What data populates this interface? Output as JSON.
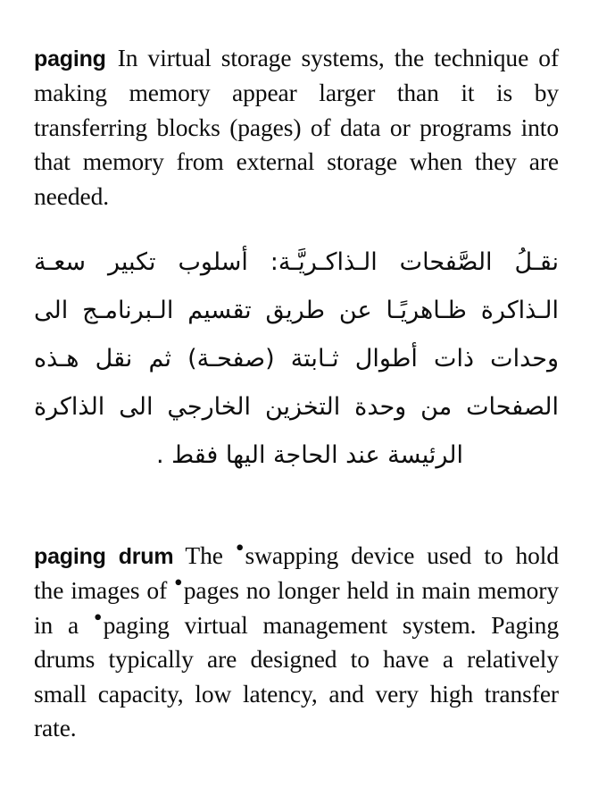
{
  "page": {
    "background_color": "#ffffff",
    "text_color": "#0d0d0d"
  },
  "entries": [
    {
      "headword": "paging",
      "definition_text": "In virtual storage systems, the technique of making memory appear larger than it is by transferring blocks (pages) of data or programs into that memory from external storage when they are needed.",
      "lines": [
        "In virtual storage systems, the",
        "technique of making memory appear lar-",
        "ger than it is by transferring blocks (pages)",
        "of data or programs into that memory from",
        "external storage when they are needed."
      ]
    },
    {
      "headword": "paging drum",
      "definition_text": "The •swapping device used to hold the images of •pages no longer held in main memory in a •paging virtual management system. Paging drums typically are designed to have a relatively small capacity, low latency, and very high transfer rate.",
      "lines": [
        "The •swapping device",
        "used to hold the images of •pages no longer",
        "held in main memory in a •paging virtual",
        "management system. Paging drums typi-",
        "cally are designed to have a relatively small",
        "capacity, low latency, and very high trans-",
        "fer rate."
      ],
      "cross_reference_marks": [
        "swapping",
        "pages",
        "paging"
      ]
    }
  ],
  "arabic": {
    "headword": "نقلُ الصَّفحات الـذاكـريَّـة",
    "full_text": "نقلُ الصَّفحات الـذاكـريَّـة: أسلوب تكبير سعـة الـذاكرة ظـاهريًـا عن طريق تقسيم الـبرنامـج الى وحدات ذات أطوال ثـابتة (صفحـة) ثم نقل هـذه الصفحات من وحدة التخزين الخارجي الى الذاكرة الرئيسة عند الحاجة اليها فقط .",
    "lines": [
      "نقـلُ الصَّفحات الـذاكـريَّـة: أسلوب تكبير سعـة",
      "الـذاكرة ظـاهريًـا عن طريق تقسيم الـبرنامـج الى",
      "وحدات ذات أطوال ثـابتة (صفحـة) ثم نقل هـذه",
      "الصفحات من وحدة التخزين الخارجي الى الذاكرة",
      "الرئيسة عند الحاجة اليها فقط ."
    ]
  },
  "symbols": {
    "cross_reference_mark": "•"
  }
}
